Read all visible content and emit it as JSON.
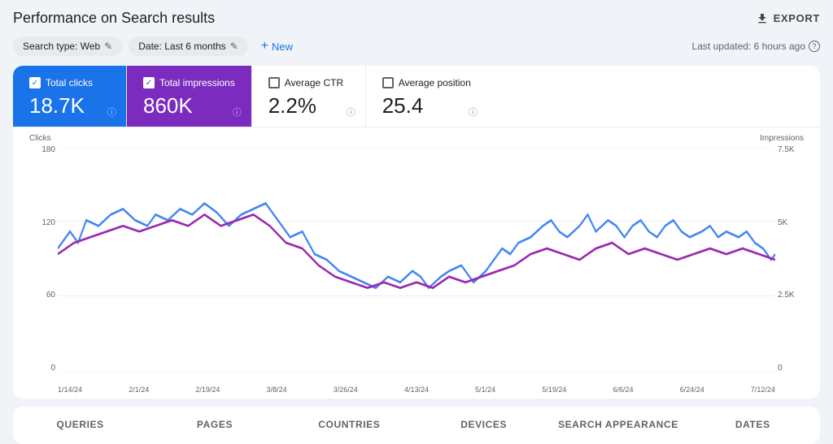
{
  "header": {
    "title": "Performance on Search results",
    "export_label": "EXPORT"
  },
  "filters": {
    "search_type_label": "Search type: Web",
    "date_label": "Date: Last 6 months",
    "new_label": "New",
    "last_updated": "Last updated: 6 hours ago"
  },
  "metrics": [
    {
      "id": "total-clicks",
      "label": "Total clicks",
      "value": "18.7K",
      "checked": true,
      "theme": "blue"
    },
    {
      "id": "total-impressions",
      "label": "Total impressions",
      "value": "860K",
      "checked": true,
      "theme": "purple"
    },
    {
      "id": "average-ctr",
      "label": "Average CTR",
      "value": "2.2%",
      "checked": false,
      "theme": "plain"
    },
    {
      "id": "average-position",
      "label": "Average position",
      "value": "25.4",
      "checked": false,
      "theme": "plain"
    }
  ],
  "chart": {
    "left_axis_title": "Clicks",
    "right_axis_title": "Impressions",
    "left_axis_values": [
      "180",
      "120",
      "60",
      "0"
    ],
    "right_axis_values": [
      "7.5K",
      "5K",
      "2.5K",
      "0"
    ],
    "x_labels": [
      "1/14/24",
      "2/1/24",
      "2/19/24",
      "3/8/24",
      "3/26/24",
      "4/13/24",
      "5/1/24",
      "5/19/24",
      "6/6/24",
      "6/24/24",
      "7/12/24"
    ]
  },
  "tabs": [
    {
      "id": "queries",
      "label": "QUERIES",
      "active": false
    },
    {
      "id": "pages",
      "label": "PAGES",
      "active": false
    },
    {
      "id": "countries",
      "label": "COUNTRIES",
      "active": false
    },
    {
      "id": "devices",
      "label": "DEVICES",
      "active": false
    },
    {
      "id": "search-appearance",
      "label": "SEARCH APPEARANCE",
      "active": false
    },
    {
      "id": "dates",
      "label": "DATES",
      "active": false
    }
  ]
}
